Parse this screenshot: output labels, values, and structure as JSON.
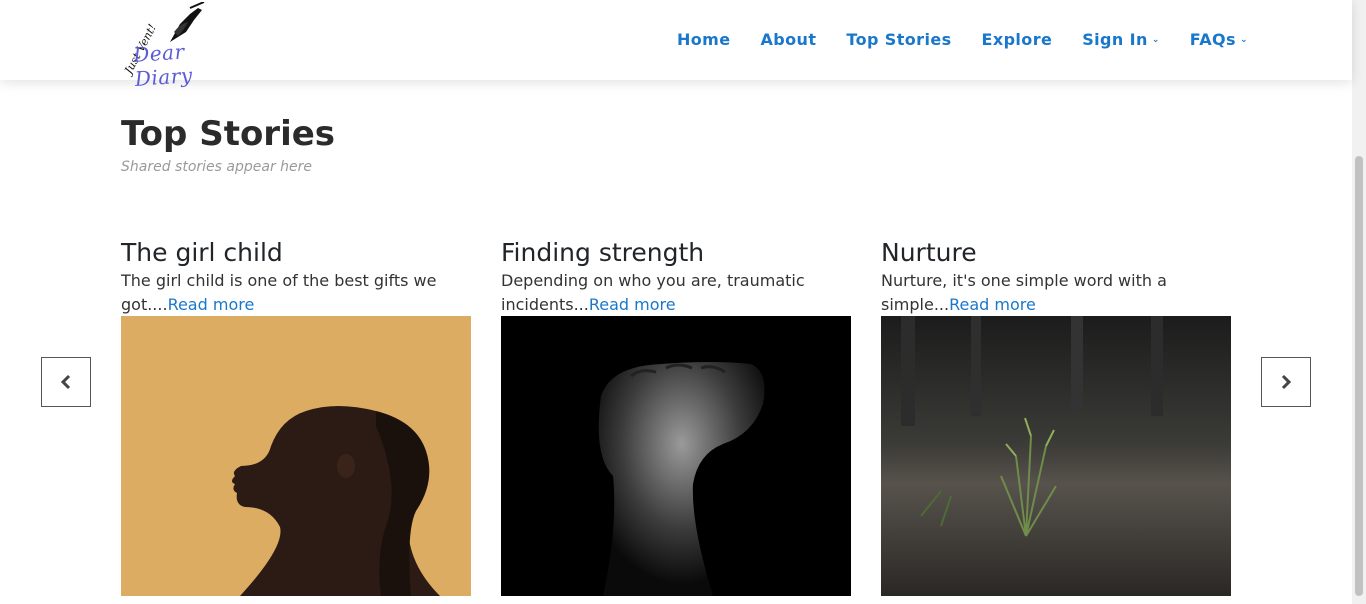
{
  "brand": {
    "logo_text_top": "Just Vent!",
    "logo_text_main": "Dear Diary"
  },
  "nav": [
    {
      "label": "Home",
      "dropdown": false
    },
    {
      "label": "About",
      "dropdown": false
    },
    {
      "label": "Top Stories",
      "dropdown": false
    },
    {
      "label": "Explore",
      "dropdown": false
    },
    {
      "label": "Sign In",
      "dropdown": true
    },
    {
      "label": "FAQs",
      "dropdown": true
    }
  ],
  "section": {
    "title": "Top Stories",
    "subtitle": "Shared stories appear here"
  },
  "stories": [
    {
      "title": "The girl child",
      "excerpt": "The girl child is one of the best gifts we got....",
      "read_more": "Read more",
      "image": "woman-profile-portrait"
    },
    {
      "title": "Finding strength",
      "excerpt": "Depending on who you are, traumatic incidents...",
      "read_more": "Read more",
      "image": "raised-fist"
    },
    {
      "title": "Nurture",
      "excerpt": "Nurture, it's one simple word with a simple...",
      "read_more": "Read more",
      "image": "plant-growing-from-ground"
    }
  ],
  "carousel": {
    "prev_icon": "chevron-left-icon",
    "next_icon": "chevron-right-icon"
  },
  "colors": {
    "accent": "#1977cc",
    "heading": "#2b2b2b",
    "subtitle": "#9a9a9a"
  }
}
